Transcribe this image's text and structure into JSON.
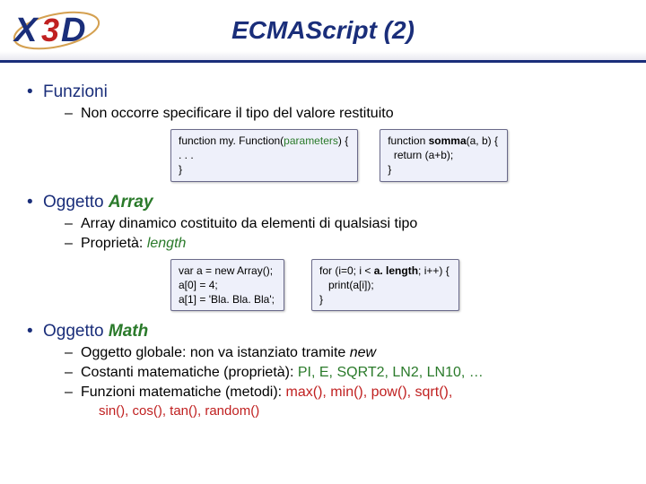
{
  "header": {
    "title": "ECMAScript (2)",
    "logo_alt": "X3D"
  },
  "sections": [
    {
      "heading": "Funzioni",
      "sub": [
        {
          "text": "Non occorre specificare il tipo del valore restituito"
        }
      ],
      "code": {
        "left": {
          "l1a": "function my. Function(",
          "l1b": "parameters",
          "l1c": ") {",
          "l2": ". . .",
          "l3": "}"
        },
        "right": {
          "l1a": "function ",
          "l1b": "somma",
          "l1c": "(a, b) {",
          "l2": "  return (a+b);",
          "l3": "}"
        }
      }
    },
    {
      "heading_prefix": "Oggetto ",
      "heading_em": "Array",
      "sub": [
        {
          "text": "Array dinamico costituito da elementi di qualsiasi tipo"
        },
        {
          "prefix": "Proprietà: ",
          "em": "length"
        }
      ],
      "code": {
        "left": {
          "l1": "var a = new Array();",
          "l2": "a[0] = 4;",
          "l3": "a[1] = 'Bla. Bla. Bla';"
        },
        "right": {
          "l1a": "for (i=0; i < ",
          "l1b": "a. length",
          "l1c": "; i++) {",
          "l2": "   print(a[i]);",
          "l3": "}"
        }
      }
    },
    {
      "heading_prefix": "Oggetto ",
      "heading_em": "Math",
      "sub": [
        {
          "prefix": "Oggetto globale: non va istanziato tramite ",
          "em": "new"
        },
        {
          "prefix": "Costanti matematiche (proprietà): ",
          "consts": "PI, E, SQRT2, LN2, LN10, …"
        },
        {
          "prefix": "Funzioni matematiche (metodi): ",
          "funcs": "max(), min(), pow(), sqrt(),"
        }
      ],
      "funcs_line2": "sin(), cos(), tan(), random()"
    }
  ]
}
